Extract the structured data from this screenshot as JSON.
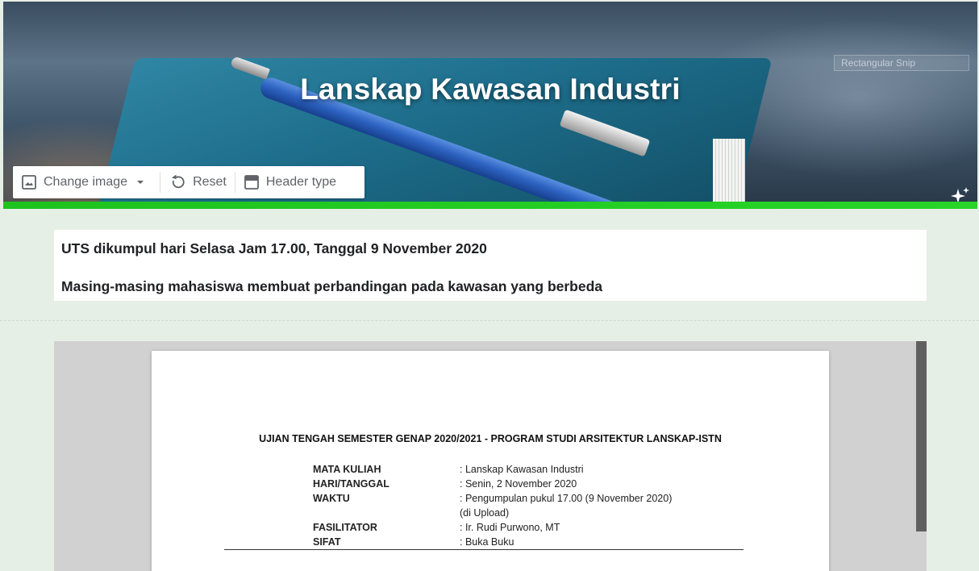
{
  "banner": {
    "title": "Lanskap Kawasan Industri",
    "ghost_label": "Rectangular Snip"
  },
  "toolbar": {
    "change_image": "Change image",
    "reset": "Reset",
    "header_type": "Header type"
  },
  "description": {
    "line1": "UTS dikumpul hari Selasa Jam 17.00, Tanggal 9 November 2020",
    "line2": "Masing-masing mahasiswa membuat perbandingan pada kawasan yang berbeda"
  },
  "document": {
    "heading": "UJIAN TENGAH SEMESTER GENAP 2020/2021 - PROGRAM STUDI ARSITEKTUR LANSKAP-ISTN",
    "rows": [
      {
        "key": "MATA KULIAH",
        "value": ": Lanskap Kawasan Industri"
      },
      {
        "key": "HARI/TANGGAL",
        "value": ": Senin, 2 November 2020"
      },
      {
        "key": "WAKTU",
        "value": ": Pengumpulan pukul 17.00 (9 November 2020)"
      },
      {
        "key": "",
        "value": "  (di Upload)"
      },
      {
        "key": "FASILITATOR",
        "value": ": Ir. Rudi Purwono, MT"
      },
      {
        "key": "SIFAT",
        "value": ": Buka Buku"
      }
    ]
  },
  "colors": {
    "accent_green": "#1ec31e",
    "page_background": "#e6efe6"
  }
}
